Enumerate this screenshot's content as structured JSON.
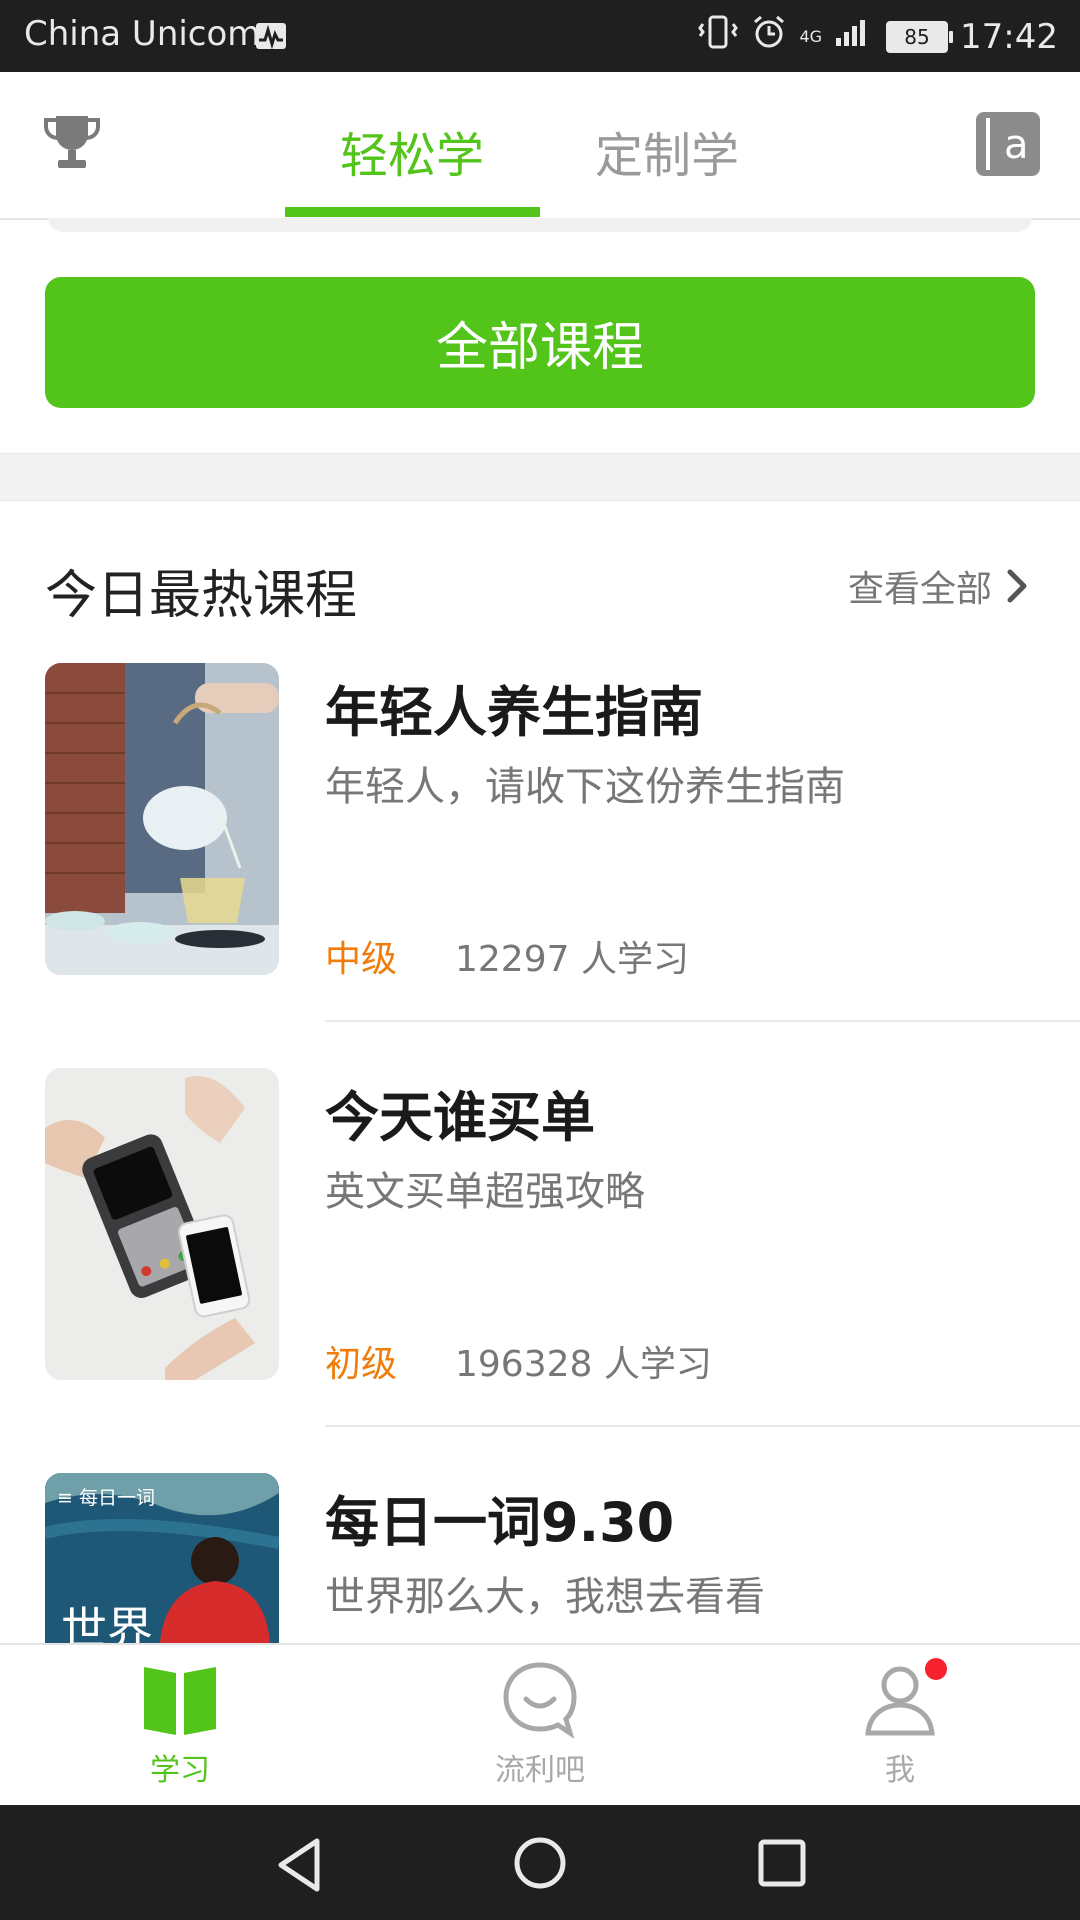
{
  "status_bar": {
    "carrier": "China Unicom",
    "network": "4G",
    "battery": "85",
    "time": "17:42"
  },
  "header": {
    "tabs": [
      {
        "label": "轻松学",
        "active": true
      },
      {
        "label": "定制学",
        "active": false
      }
    ],
    "left_icon": "trophy-icon",
    "right_icon": "dictionary-icon",
    "right_icon_letter": "a"
  },
  "all_courses_button": "全部课程",
  "hot_section": {
    "title": "今日最热课程",
    "view_all": "查看全部"
  },
  "courses": [
    {
      "title": "年轻人养生指南",
      "desc": "年轻人，请收下这份养生指南",
      "level": "中级",
      "learners": "12297 人学习"
    },
    {
      "title": "今天谁买单",
      "desc": "英文买单超强攻略",
      "level": "初级",
      "learners": "196328 人学习"
    },
    {
      "title": "每日一词9.30",
      "desc": "世界那么大，我想去看看",
      "thumb_tag": "≡ 每日一词",
      "thumb_text": "世界"
    }
  ],
  "bottom_nav": [
    {
      "label": "学习",
      "icon": "book-icon",
      "active": true
    },
    {
      "label": "流利吧",
      "icon": "smile-chat-icon",
      "active": false
    },
    {
      "label": "我",
      "icon": "person-icon",
      "active": false,
      "badge": true
    }
  ],
  "colors": {
    "accent": "#52c41a",
    "level": "#f07c0a",
    "badge": "#f5222d"
  }
}
